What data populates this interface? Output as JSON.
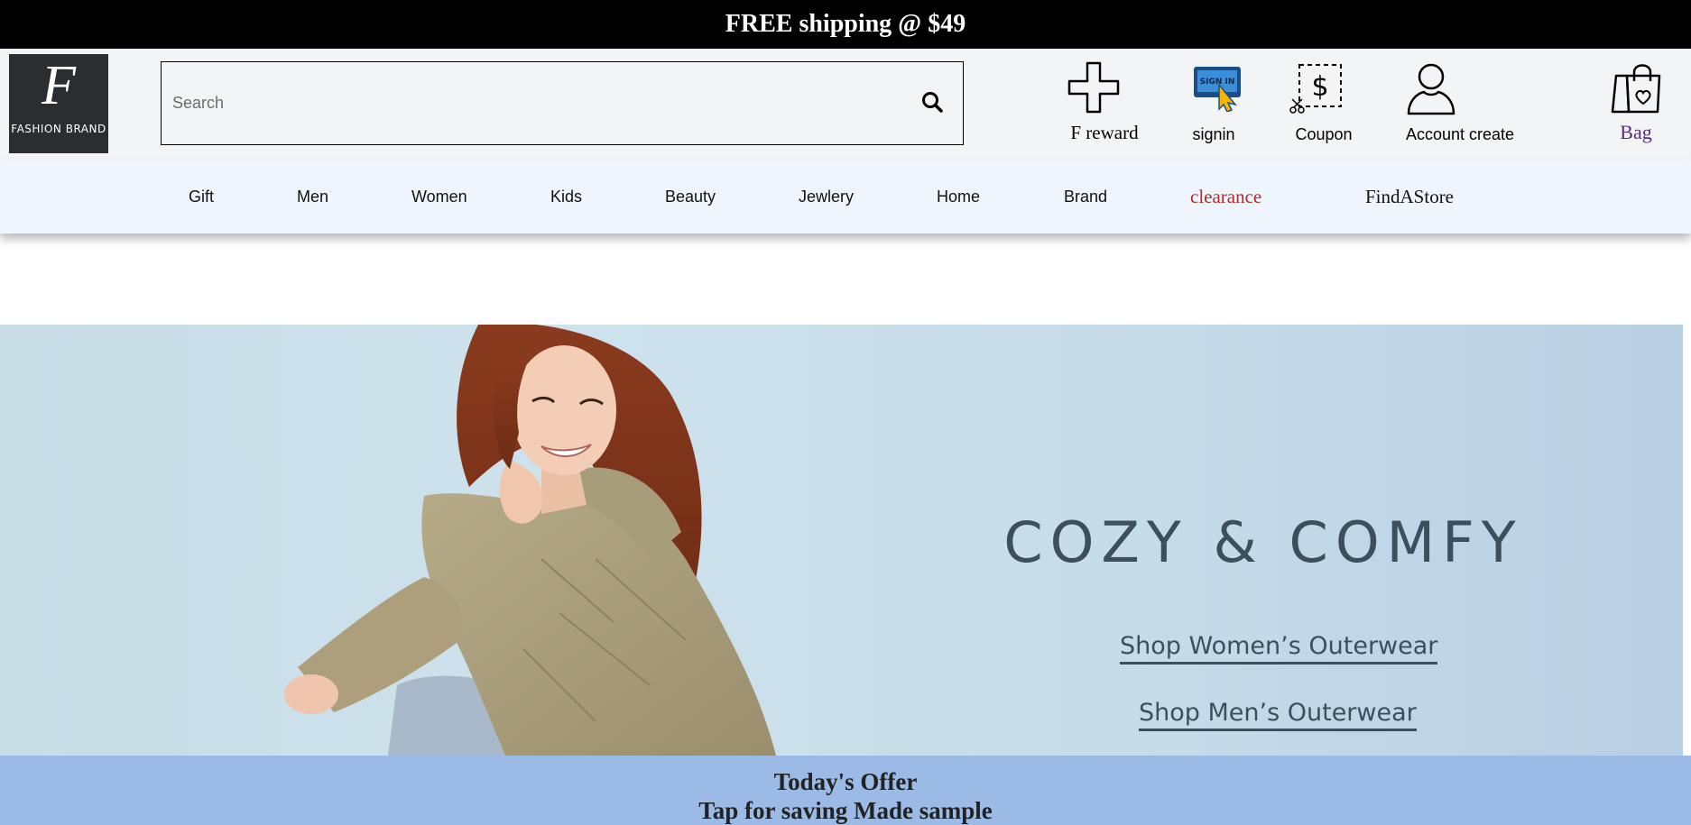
{
  "promo": {
    "text": "FREE shipping @ $49"
  },
  "header": {
    "logo": {
      "letter": "F",
      "text": "FASHION BRAND"
    },
    "search": {
      "placeholder": "Search",
      "value": ""
    },
    "reward_label": "F reward",
    "signin_label": "signin",
    "signin_icon_text": "SIGN IN",
    "coupon_label": "Coupon",
    "coupon_symbol": "$",
    "account_label": "Account create",
    "bag_label": "Bag"
  },
  "nav": {
    "items": [
      {
        "label": "Gift"
      },
      {
        "label": "Men"
      },
      {
        "label": "Women"
      },
      {
        "label": "Kids"
      },
      {
        "label": "Beauty"
      },
      {
        "label": "Jewlery"
      },
      {
        "label": "Home"
      },
      {
        "label": "Brand"
      },
      {
        "label": "clearance"
      },
      {
        "label": "FindAStore"
      }
    ],
    "clearance_color": "#b42a2a"
  },
  "hero": {
    "title": "COZY & COMFY",
    "link_women": "Shop Women’s Outerwear",
    "link_men": "Shop Men’s Outerwear",
    "image": "woman-in-puffer-jacket-photo"
  },
  "offer": {
    "line1": "Today's Offer",
    "line2": "Tap for saving Made sample",
    "background": "#9bbbe6"
  }
}
